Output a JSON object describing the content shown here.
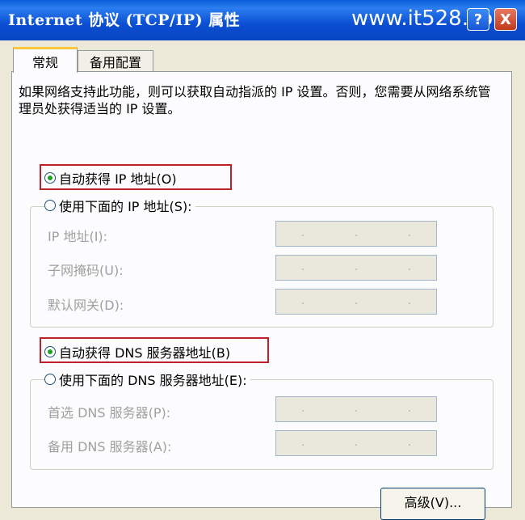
{
  "window": {
    "title": "Internet 协议 (TCP/IP) 属性",
    "watermark": "www.it528.com",
    "help_label": "?",
    "close_label": "X"
  },
  "tabs": [
    {
      "label": "常规",
      "active": true
    },
    {
      "label": "备用配置",
      "active": false
    }
  ],
  "description": "如果网络支持此功能，则可以获取自动指派的 IP 设置。否则，您需要从网络系统管理员处获得适当的 IP 设置。",
  "ip": {
    "auto_label": "自动获得 IP 地址(O)",
    "manual_label": "使用下面的 IP 地址(S):",
    "auto_selected": true,
    "fields": [
      {
        "label": "IP 地址(I):",
        "value": ""
      },
      {
        "label": "子网掩码(U):",
        "value": ""
      },
      {
        "label": "默认网关(D):",
        "value": ""
      }
    ]
  },
  "dns": {
    "auto_label": "自动获得 DNS 服务器地址(B)",
    "manual_label": "使用下面的 DNS 服务器地址(E):",
    "auto_selected": true,
    "fields": [
      {
        "label": "首选 DNS 服务器(P):",
        "value": ""
      },
      {
        "label": "备用 DNS 服务器(A):",
        "value": ""
      }
    ]
  },
  "advanced_button": "高级(V)...",
  "colors": {
    "titlebar": "#0b4ed2",
    "highlight": "#c0202a",
    "radio_selected": "#21a121"
  }
}
